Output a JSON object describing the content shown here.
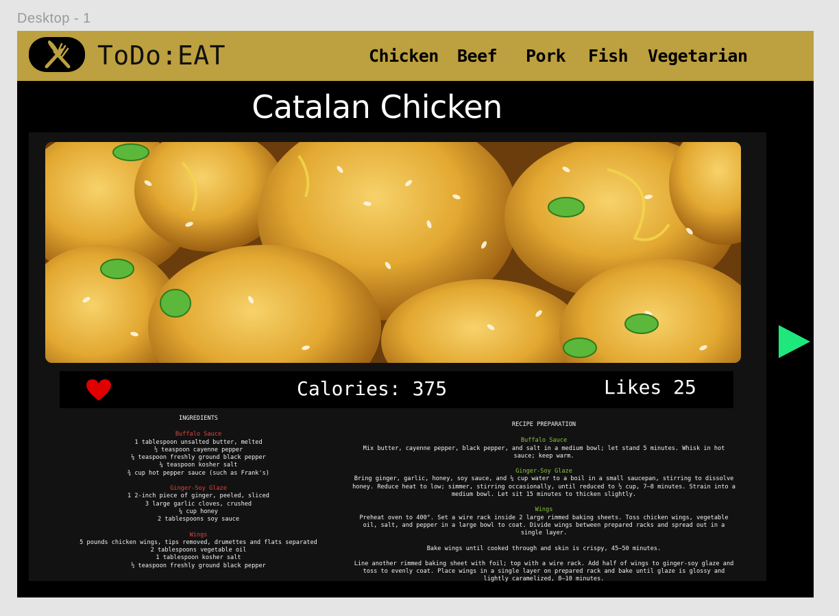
{
  "canvas": {
    "frame_label": "Desktop - 1"
  },
  "header": {
    "brand": "ToDo:EAT",
    "nav": [
      "Chicken",
      "Beef",
      "Pork",
      "Fish",
      "Vegetarian"
    ]
  },
  "recipe": {
    "title": "Catalan Chicken",
    "calories_label": "Calories: 375",
    "likes_label": "Likes 25"
  },
  "ingredients": {
    "heading": "INGREDIENTS",
    "groups": [
      {
        "name": "Buffalo Sauce",
        "items": [
          "1 tablespoon unsalted butter, melted",
          "½ teaspoon cayenne pepper",
          "¼ teaspoon freshly ground black pepper",
          "¼ teaspoon kosher salt",
          "¾ cup hot pepper sauce (such as Frank's)"
        ]
      },
      {
        "name": "Ginger-Soy Glaze",
        "items": [
          "1 2-inch piece of ginger, peeled, sliced",
          "3 large garlic cloves, crushed",
          "¼ cup honey",
          "2 tablespoons soy sauce"
        ]
      },
      {
        "name": "Wings",
        "items": [
          "5 pounds chicken wings, tips removed, drumettes and flats separated",
          "2 tablespoons vegetable oil",
          "1 tablespoon kosher salt",
          "½ teaspoon freshly ground black pepper"
        ]
      }
    ]
  },
  "preparation": {
    "heading": "RECIPE PREPARATION",
    "groups": [
      {
        "name": "Buffalo Sauce",
        "paragraphs": [
          "Mix butter, cayenne pepper, black pepper, and salt in a medium bowl; let stand 5 minutes. Whisk in hot sauce; keep warm."
        ]
      },
      {
        "name": "Ginger-Soy Glaze",
        "paragraphs": [
          "Bring ginger, garlic, honey, soy sauce, and ¼ cup water to a boil in a small saucepan, stirring to dissolve honey. Reduce heat to low; simmer, stirring occasionally, until reduced to ½ cup, 7–8 minutes. Strain into a medium bowl. Let sit 15 minutes to thicken slightly."
        ]
      },
      {
        "name": "Wings",
        "paragraphs": [
          "Preheat oven to 400°. Set a wire rack inside 2 large rimmed baking sheets. Toss chicken wings, vegetable oil, salt, and pepper in a large bowl to coat. Divide wings between prepared racks and spread out in a single layer.",
          "Bake wings until cooked through and skin is crispy, 45–50 minutes.",
          "Line another rimmed baking sheet with foil; top with a wire rack. Add half of wings to ginger-soy glaze and toss to evenly coat. Place wings in a single layer on prepared rack and bake until glaze is glossy and lightly caramelized, 8–10 minutes."
        ]
      }
    ]
  },
  "colors": {
    "header_bg": "#bda03f",
    "page_bg": "#000000",
    "panel_bg": "#121212",
    "ingredient_section": "#e0463a",
    "preparation_section": "#8cc63e",
    "heart": "#e00000",
    "next_arrow": "#1ee87c"
  },
  "icons": {
    "logo": "fork-knife-icon",
    "like": "heart-icon",
    "next": "play-arrow-icon"
  }
}
